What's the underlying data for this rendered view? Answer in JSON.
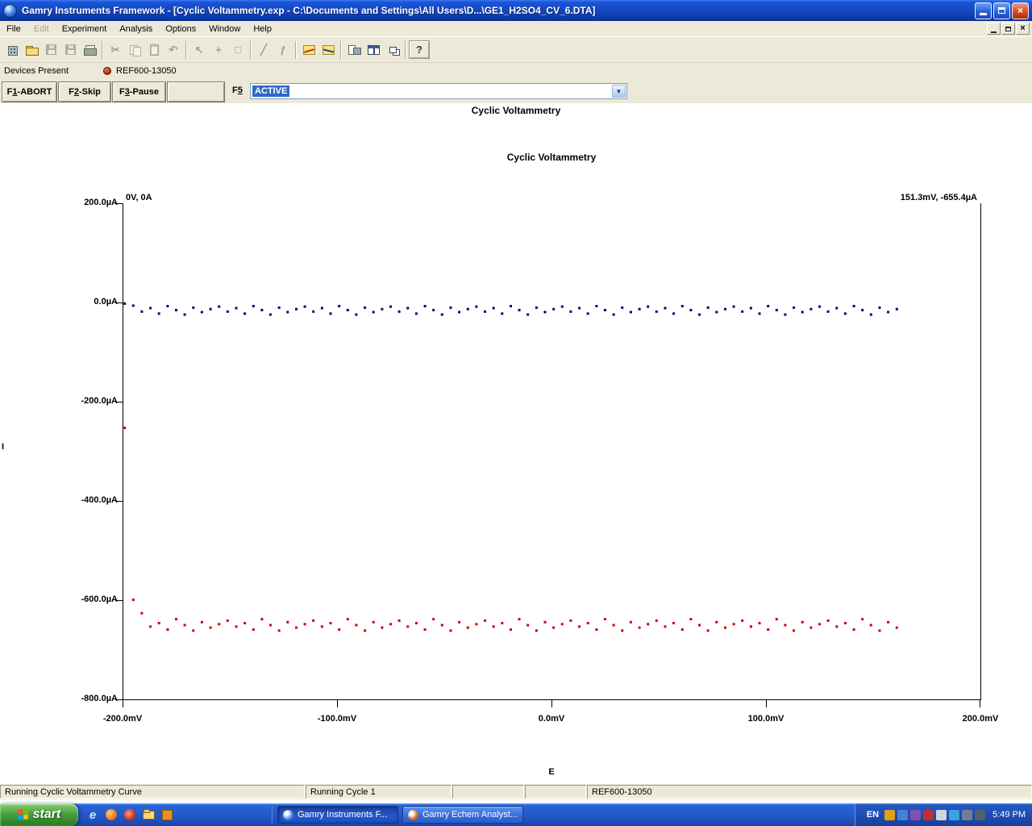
{
  "window": {
    "title": "Gamry Instruments Framework - [Cyclic Voltammetry.exp - C:\\Documents and Settings\\All Users\\D...\\GE1_H2SO4_CV_6.DTA]"
  },
  "menubar": {
    "items": [
      {
        "label": "File",
        "enabled": true
      },
      {
        "label": "Edit",
        "enabled": false
      },
      {
        "label": "Experiment",
        "enabled": true
      },
      {
        "label": "Analysis",
        "enabled": true
      },
      {
        "label": "Options",
        "enabled": true
      },
      {
        "label": "Window",
        "enabled": true
      },
      {
        "label": "Help",
        "enabled": true
      }
    ]
  },
  "toolbar": {
    "buttons": [
      {
        "name": "instrument-icon"
      },
      {
        "name": "open-icon"
      },
      {
        "name": "save-icon",
        "disabled": true
      },
      {
        "name": "save-as-icon",
        "disabled": true
      },
      {
        "name": "print-icon"
      },
      {
        "name": "cut-icon",
        "glyph": "✂",
        "disabled": true
      },
      {
        "name": "copy-icon",
        "disabled": true
      },
      {
        "name": "paste-icon",
        "disabled": true
      },
      {
        "name": "undo-icon",
        "glyph": "↶",
        "disabled": true
      },
      {
        "name": "select-pointer-icon",
        "glyph": "↖",
        "disabled": true
      },
      {
        "name": "select-region-icon",
        "glyph": "+",
        "disabled": true
      },
      {
        "name": "deselect-icon",
        "glyph": "□",
        "disabled": true
      },
      {
        "name": "line-tool-icon",
        "glyph": "╱",
        "disabled": true
      },
      {
        "name": "function-icon",
        "glyph": "ƒ",
        "disabled": true
      },
      {
        "name": "analyst-chart-icon"
      },
      {
        "name": "curve-chart-icon"
      },
      {
        "name": "print-preview-icon"
      },
      {
        "name": "split-window-icon"
      },
      {
        "name": "cascade-windows-icon"
      },
      {
        "name": "help-icon",
        "glyph": "?"
      }
    ]
  },
  "devices_bar": {
    "label": "Devices Present",
    "device": "REF600-13050"
  },
  "controls": {
    "f_buttons": [
      {
        "pre": "F",
        "key": "1",
        "rest": "-ABORT"
      },
      {
        "pre": "F",
        "key": "2",
        "rest": "-Skip"
      },
      {
        "pre": "F",
        "key": "3",
        "rest": "-Pause"
      }
    ],
    "f5": {
      "pre": "F",
      "key": "5"
    },
    "combo_value": "ACTIVE"
  },
  "headings": {
    "experiment_title": "Cyclic Voltammetry"
  },
  "chart_data": {
    "type": "scatter",
    "title": "Cyclic Voltammetry",
    "xlabel": "E",
    "ylabel": "I",
    "x_unit": "mV",
    "y_unit": "µA",
    "xlim": [
      -200,
      200
    ],
    "ylim": [
      -800,
      200
    ],
    "grid": false,
    "x_ticks": [
      "-200.0mV",
      "-100.0mV",
      "0.0mV",
      "100.0mV",
      "200.0mV"
    ],
    "y_ticks": [
      "200.0µA",
      "0.0µA",
      "-200.0µA",
      "-400.0µA",
      "-600.0µA",
      "-800.0µA"
    ],
    "annotations": [
      {
        "text": "0V, 0A",
        "position": "top-left"
      },
      {
        "text": "151.3mV, -655.4µA",
        "position": "top-right"
      }
    ],
    "x": [
      -199,
      -195,
      -191,
      -187,
      -183,
      -179,
      -175,
      -171,
      -167,
      -163,
      -159,
      -155,
      -151,
      -147,
      -143,
      -139,
      -135,
      -131,
      -127,
      -123,
      -119,
      -115,
      -111,
      -107,
      -103,
      -99,
      -95,
      -91,
      -87,
      -83,
      -79,
      -75,
      -71,
      -67,
      -63,
      -59,
      -55,
      -51,
      -47,
      -43,
      -39,
      -35,
      -31,
      -27,
      -23,
      -19,
      -15,
      -11,
      -7,
      -3,
      1,
      5,
      9,
      13,
      17,
      21,
      25,
      29,
      33,
      37,
      41,
      45,
      49,
      53,
      57,
      61,
      65,
      69,
      73,
      77,
      81,
      85,
      89,
      93,
      97,
      101,
      105,
      109,
      113,
      117,
      121,
      125,
      129,
      133,
      137,
      141,
      145,
      149,
      153,
      157,
      161
    ],
    "series": [
      {
        "name": "forward-sweep",
        "color": "#000080",
        "values": [
          -2,
          -6,
          -18,
          -11,
          -22,
          -7,
          -15,
          -24,
          -10,
          -19,
          -13,
          -8,
          -18,
          -11,
          -22,
          -7,
          -15,
          -24,
          -10,
          -19,
          -13,
          -8,
          -18,
          -11,
          -22,
          -7,
          -15,
          -24,
          -10,
          -19,
          -13,
          -8,
          -18,
          -11,
          -22,
          -7,
          -15,
          -24,
          -10,
          -19,
          -13,
          -8,
          -18,
          -11,
          -22,
          -7,
          -15,
          -24,
          -10,
          -19,
          -13,
          -8,
          -18,
          -11,
          -22,
          -7,
          -15,
          -24,
          -10,
          -19,
          -13,
          -8,
          -18,
          -11,
          -22,
          -7,
          -15,
          -24,
          -10,
          -19,
          -13,
          -8,
          -18,
          -11,
          -22,
          -7,
          -15,
          -24,
          -10,
          -19,
          -13,
          -8,
          -18,
          -11,
          -22,
          -7,
          -15,
          -24,
          -10,
          -19,
          -13
        ]
      },
      {
        "name": "reverse-sweep",
        "color": "#cc0000",
        "values": [
          -252,
          -598,
          -625,
          -652,
          -645,
          -658,
          -637,
          -649,
          -660,
          -643,
          -654,
          -647,
          -640,
          -652,
          -645,
          -658,
          -637,
          -649,
          -660,
          -643,
          -654,
          -647,
          -640,
          -652,
          -645,
          -658,
          -637,
          -649,
          -660,
          -643,
          -654,
          -647,
          -640,
          -652,
          -645,
          -658,
          -637,
          -649,
          -660,
          -643,
          -654,
          -647,
          -640,
          -652,
          -645,
          -658,
          -637,
          -649,
          -660,
          -643,
          -654,
          -647,
          -640,
          -652,
          -645,
          -658,
          -637,
          -649,
          -660,
          -643,
          -654,
          -647,
          -640,
          -652,
          -645,
          -658,
          -637,
          -649,
          -660,
          -643,
          -654,
          -647,
          -640,
          -652,
          -645,
          -658,
          -637,
          -649,
          -660,
          -643,
          -654,
          -647,
          -640,
          -652,
          -645,
          -658,
          -637,
          -649,
          -660,
          -643,
          -654
        ]
      }
    ]
  },
  "statusbar": {
    "segments": [
      "Running Cyclic Voltammetry Curve",
      "Running Cycle 1",
      "",
      "",
      "REF600-13050"
    ]
  },
  "taskbar": {
    "start_label": "start",
    "buttons": [
      {
        "label": "Gamry Instruments F..."
      },
      {
        "label": "Gamry Echem Analyst..."
      }
    ],
    "tray": {
      "lang": "EN",
      "time": "5:49 PM"
    }
  }
}
